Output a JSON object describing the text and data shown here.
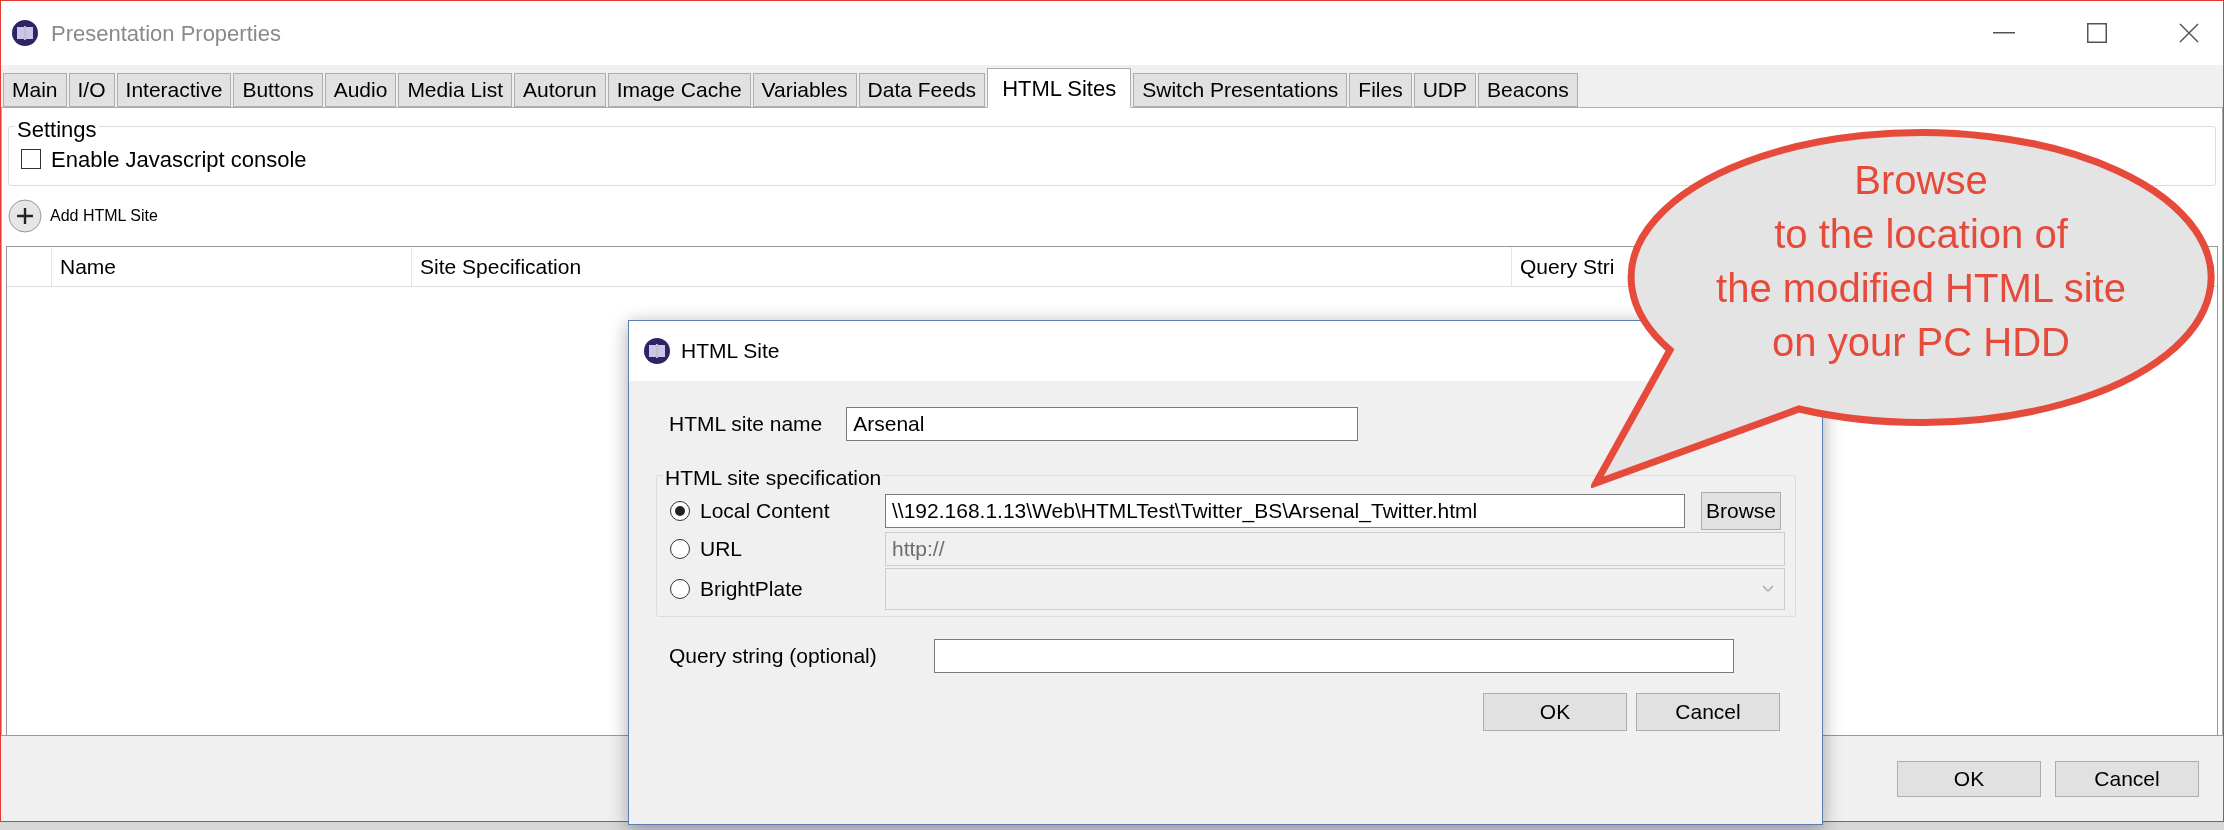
{
  "window": {
    "title": "Presentation Properties"
  },
  "tabs": [
    {
      "label": "Main",
      "selected": false
    },
    {
      "label": "I/O",
      "selected": false
    },
    {
      "label": "Interactive",
      "selected": false
    },
    {
      "label": "Buttons",
      "selected": false
    },
    {
      "label": "Audio",
      "selected": false
    },
    {
      "label": "Media List",
      "selected": false
    },
    {
      "label": "Autorun",
      "selected": false
    },
    {
      "label": "Image Cache",
      "selected": false
    },
    {
      "label": "Variables",
      "selected": false
    },
    {
      "label": "Data Feeds",
      "selected": false
    },
    {
      "label": "HTML Sites",
      "selected": true
    },
    {
      "label": "Switch Presentations",
      "selected": false
    },
    {
      "label": "Files",
      "selected": false
    },
    {
      "label": "UDP",
      "selected": false
    },
    {
      "label": "Beacons",
      "selected": false
    }
  ],
  "settings": {
    "title": "Settings",
    "options": [
      {
        "label": "Enable Javascript console",
        "checked": false
      }
    ]
  },
  "add_button": "Add HTML Site",
  "table": {
    "columns": [
      "Name",
      "Site Specification",
      "Query Stri"
    ]
  },
  "buttons": [
    "OK",
    "Cancel"
  ],
  "dialog": {
    "title": "HTML Site",
    "name_label": "HTML site name",
    "name_value": "Arsenal",
    "spec_title": "HTML site specification",
    "options": [
      {
        "label": "Local Content",
        "selected": true,
        "kind": "text",
        "value": "\\\\192.168.1.13\\Web\\HTMLTest\\Twitter_BS\\Arsenal_Twitter.html",
        "disabled": false,
        "button": "Browse"
      },
      {
        "label": "URL",
        "selected": false,
        "kind": "text",
        "value": "http://",
        "disabled": true
      },
      {
        "label": "BrightPlate",
        "selected": false,
        "kind": "dropdown",
        "disabled": true
      }
    ],
    "query_label": "Query string (optional)",
    "buttons": [
      "OK",
      "Cancel"
    ]
  },
  "callout": {
    "lines": [
      "Browse",
      "to the location of",
      "the modified HTML site",
      "on your PC HDD"
    ]
  }
}
